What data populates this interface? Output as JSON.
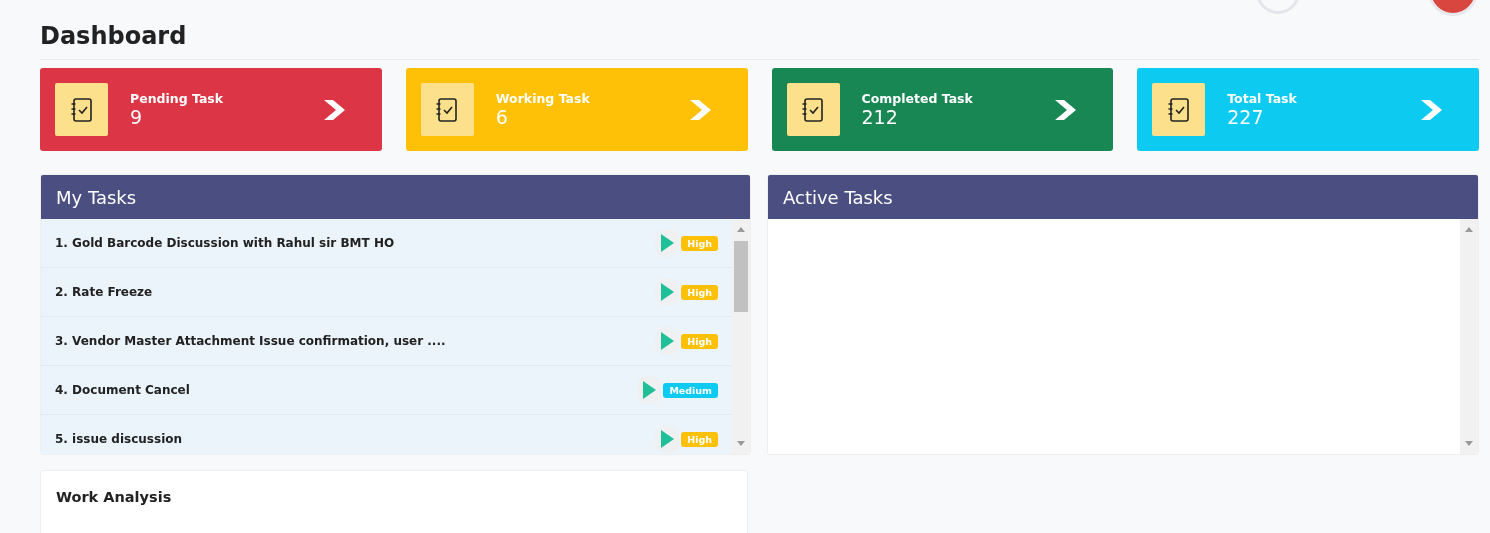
{
  "page_title": "Dashboard",
  "summary_cards": [
    {
      "label": "Pending Task",
      "count": "9",
      "color": "#dc3545"
    },
    {
      "label": "Working Task",
      "count": "6",
      "color": "#ffc107"
    },
    {
      "label": "Completed Task",
      "count": "212",
      "color": "#198754"
    },
    {
      "label": "Total Task",
      "count": "227",
      "color": "#0dcaf0"
    }
  ],
  "my_tasks": {
    "title": "My Tasks",
    "tasks": [
      {
        "name": "1. Gold Barcode Discussion with Rahul sir BMT HO",
        "priority": "High",
        "kind": "high"
      },
      {
        "name": "2. Rate Freeze",
        "priority": "High",
        "kind": "high"
      },
      {
        "name": "3. Vendor Master Attachment Issue confirmation, user ....",
        "priority": "High",
        "kind": "high"
      },
      {
        "name": "4. Document Cancel",
        "priority": "Medium",
        "kind": "medium"
      },
      {
        "name": "5. issue discussion",
        "priority": "High",
        "kind": "high"
      }
    ]
  },
  "active_tasks": {
    "title": "Active Tasks"
  },
  "work_analysis": {
    "title": "Work Analysis"
  }
}
